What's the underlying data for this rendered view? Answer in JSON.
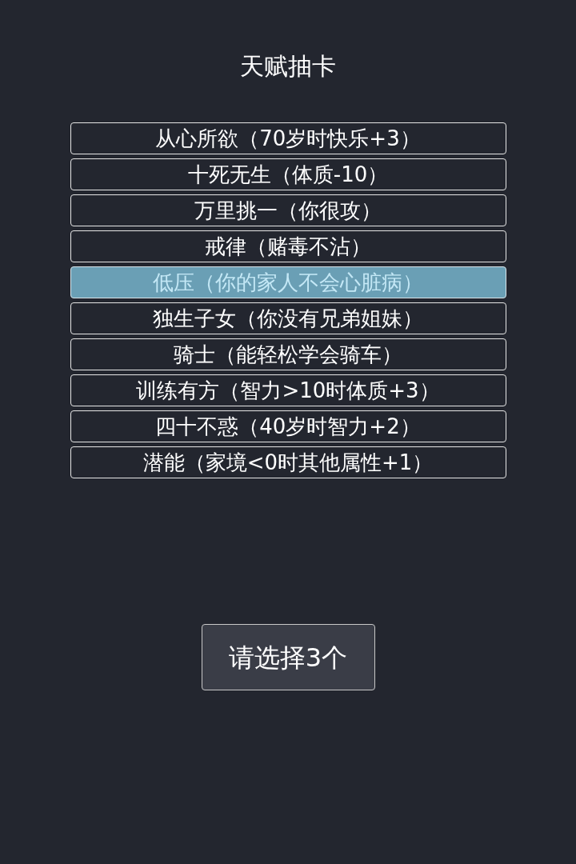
{
  "title": "天赋抽卡",
  "talents": [
    {
      "label": "从心所欲（70岁时快乐+3）",
      "selected": false
    },
    {
      "label": "十死无生（体质-10）",
      "selected": false
    },
    {
      "label": "万里挑一（你很攻）",
      "selected": false
    },
    {
      "label": "戒律（赌毒不沾）",
      "selected": false
    },
    {
      "label": "低压（你的家人不会心脏病）",
      "selected": true
    },
    {
      "label": "独生子女（你没有兄弟姐妹）",
      "selected": false
    },
    {
      "label": "骑士（能轻松学会骑车）",
      "selected": false
    },
    {
      "label": "训练有方（智力>10时体质+3）",
      "selected": false
    },
    {
      "label": "四十不惑（40岁时智力+2）",
      "selected": false
    },
    {
      "label": "潜能（家境<0时其他属性+1）",
      "selected": false
    }
  ],
  "confirm_button": {
    "label": "请选择3个"
  }
}
